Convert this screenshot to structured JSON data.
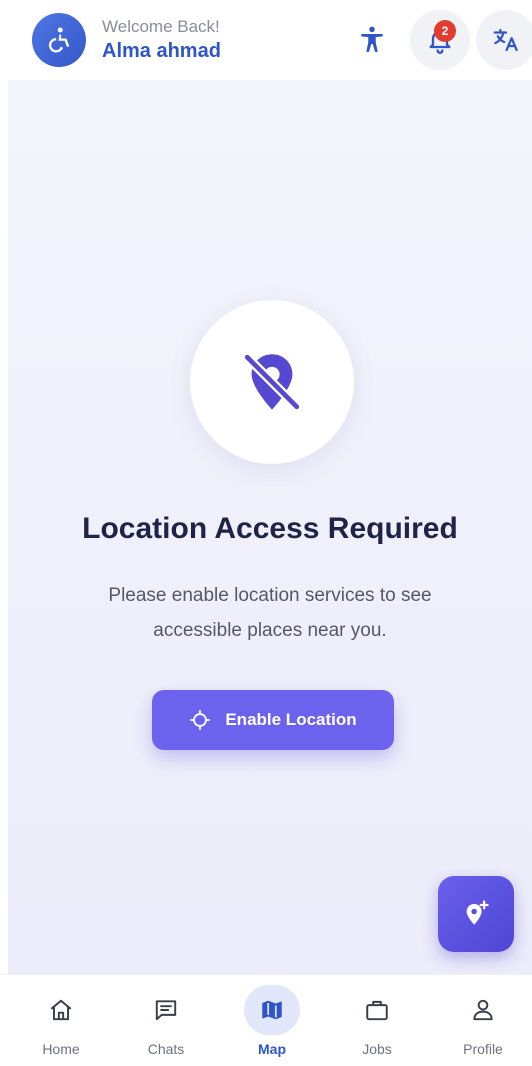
{
  "header": {
    "welcome_text": "Welcome Back!",
    "user_name": "Alma ahmad",
    "notification_count": "2",
    "logo_icon": "wheelchair-icon",
    "actions": [
      "accessibility-icon",
      "bell-icon",
      "translate-icon"
    ]
  },
  "main": {
    "title": "Location Access Required",
    "description": "Please enable location services to see accessible places near you.",
    "enable_button_label": "Enable Location",
    "status_icon": "location-off-icon",
    "fab_icon": "add-location-icon"
  },
  "nav": {
    "items": [
      {
        "label": "Home",
        "icon": "home-icon"
      },
      {
        "label": "Chats",
        "icon": "chat-icon"
      },
      {
        "label": "Map",
        "icon": "map-icon"
      },
      {
        "label": "Jobs",
        "icon": "briefcase-icon"
      },
      {
        "label": "Profile",
        "icon": "person-icon"
      }
    ],
    "active": "Map"
  },
  "colors": {
    "primary": "#2f55c8",
    "accent": "#6b62ee",
    "badge": "#e23b30",
    "background": "#f0f0fb"
  }
}
